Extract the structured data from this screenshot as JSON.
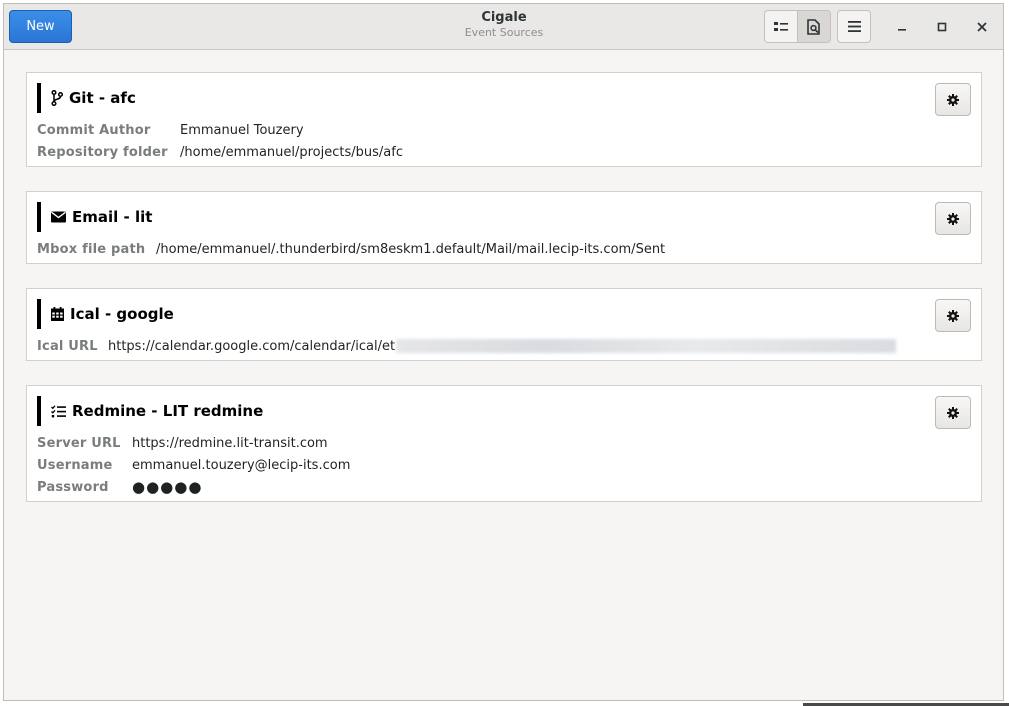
{
  "window": {
    "title": "Cigale",
    "subtitle": "Event Sources"
  },
  "header": {
    "new_label": "New",
    "icons": {
      "list_view": "list-view-icon",
      "detail_view": "document-search-icon",
      "menu": "hamburger-menu-icon",
      "minimize": "minimize-icon",
      "maximize": "maximize-icon",
      "close": "close-icon"
    }
  },
  "colors": {
    "accent": "#3584e4",
    "card_bar": "#000000",
    "label": "#7a7d7e"
  },
  "sources": [
    {
      "title": "Git - afc",
      "icon": "git-branch-icon",
      "fields": [
        {
          "label": "Commit Author",
          "value": "Emmanuel Touzery"
        },
        {
          "label": "Repository folder",
          "value": "/home/emmanuel/projects/bus/afc"
        }
      ]
    },
    {
      "title": "Email - lit",
      "icon": "envelope-icon",
      "fields": [
        {
          "label": "Mbox file path",
          "value": "/home/emmanuel/.thunderbird/sm8eskm1.default/Mail/mail.lecip-its.com/Sent"
        }
      ]
    },
    {
      "title": "Ical - google",
      "icon": "calendar-icon",
      "fields": [
        {
          "label": "Ical URL",
          "value": "https://calendar.google.com/calendar/ical/et"
        }
      ]
    },
    {
      "title": "Redmine - LIT redmine",
      "icon": "tasks-icon",
      "fields": [
        {
          "label": "Server URL",
          "value": "https://redmine.lit-transit.com"
        },
        {
          "label": "Username",
          "value": "emmanuel.touzery@lecip-its.com"
        },
        {
          "label": "Password",
          "value": "●●●●●"
        }
      ]
    }
  ]
}
